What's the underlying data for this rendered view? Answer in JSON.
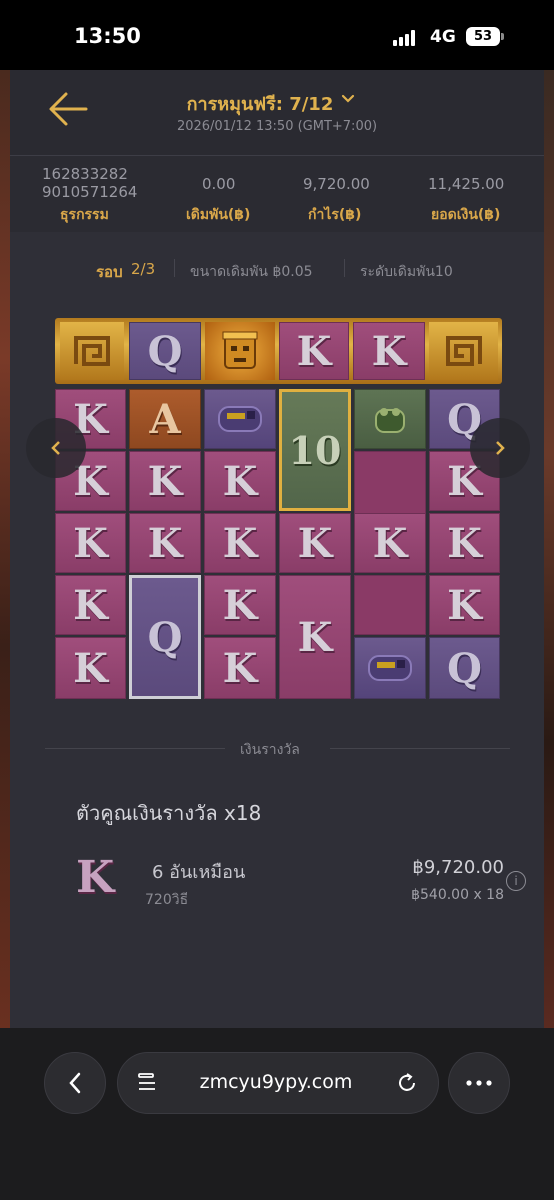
{
  "status_bar": {
    "time": "13:50",
    "network": "4G",
    "battery": "53"
  },
  "header": {
    "title": "การหมุนฟรี: 7/12",
    "datetime": "2026/01/12 13:50 (GMT+7:00)"
  },
  "stats": [
    {
      "value_line1": "162833282",
      "value_line2": "9010571264",
      "label": "ธุรกรรม"
    },
    {
      "value": "0.00",
      "label": "เดิมพัน(฿)"
    },
    {
      "value": "9,720.00",
      "label": "กำไร(฿)"
    },
    {
      "value": "11,425.00",
      "label": "ยอดเงิน(฿)"
    }
  ],
  "round": {
    "label": "รอบ",
    "value": "2/3",
    "bet_size": "ขนาดเดิมพัน ฿0.05",
    "bet_level": "ระดับเดิมพัน10"
  },
  "reels": {
    "top_row": [
      "wild-spiral",
      "Q",
      "mask",
      "K",
      "K",
      "wild-spiral"
    ],
    "col1": [
      "K",
      "K",
      "K",
      "K",
      "K"
    ],
    "col2": [
      "A",
      "K",
      "K",
      "Q"
    ],
    "col3": [
      "jaguar",
      "K",
      "K",
      "K",
      "K"
    ],
    "col4": [
      "10",
      "K",
      "K"
    ],
    "col5": [
      "frog",
      "",
      "K",
      "jaguar"
    ],
    "col6": [
      "Q",
      "K",
      "K",
      "K",
      "Q"
    ],
    "mult_10_label": "10"
  },
  "prize": {
    "section_title": "เงินรางวัล",
    "multiplier_text": "ตัวคูณเงินรางวัล x18",
    "symbol": "K",
    "same_text": "6 อันเหมือน",
    "ways_text": "720วิธี",
    "amount": "฿9,720.00",
    "detail": "฿540.00 x 18"
  },
  "browser": {
    "url": "zmcyu9ypy.com"
  }
}
